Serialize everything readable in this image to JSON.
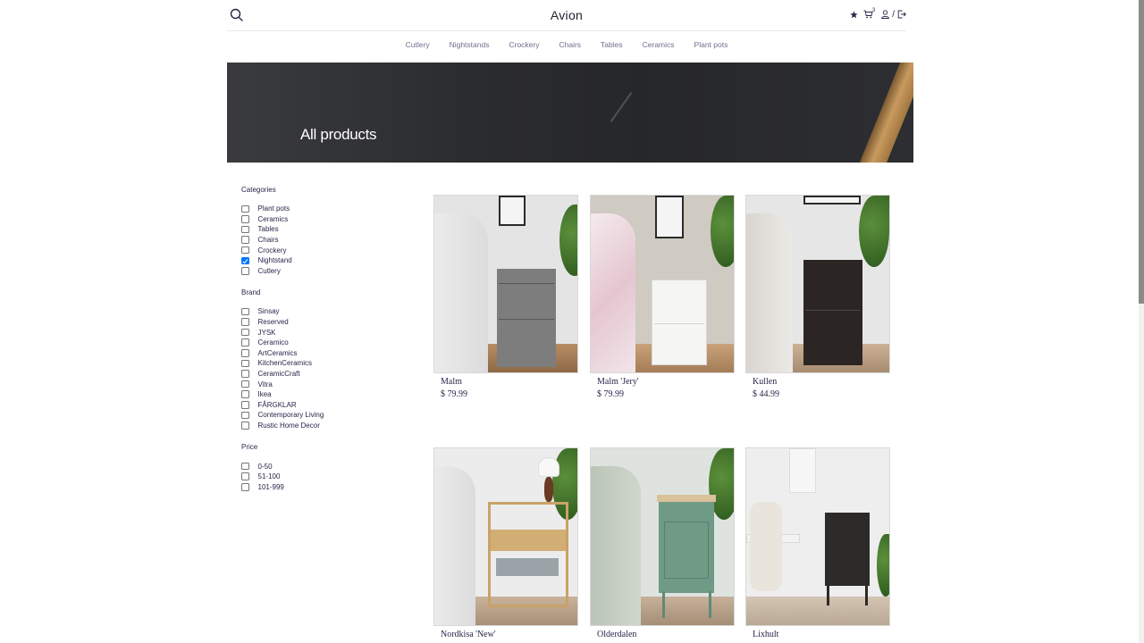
{
  "header": {
    "logo": "Avion",
    "cart_count": "3",
    "separator": "/"
  },
  "nav": {
    "items": [
      "Cutlery",
      "Nightstands",
      "Crockery",
      "Chairs",
      "Tables",
      "Ceramics",
      "Plant pots"
    ]
  },
  "hero": {
    "title": "All products"
  },
  "filters": {
    "categories": {
      "title": "Categories",
      "options": [
        {
          "label": "Plant pots",
          "checked": false
        },
        {
          "label": "Ceramics",
          "checked": false
        },
        {
          "label": "Tables",
          "checked": false
        },
        {
          "label": "Chairs",
          "checked": false
        },
        {
          "label": "Crockery",
          "checked": false
        },
        {
          "label": "Nightstand",
          "checked": true
        },
        {
          "label": "Cutlery",
          "checked": false
        }
      ]
    },
    "brand": {
      "title": "Brand",
      "options": [
        {
          "label": "Sinsay",
          "checked": false
        },
        {
          "label": "Reserved",
          "checked": false
        },
        {
          "label": "JYSK",
          "checked": false
        },
        {
          "label": "Ceramico",
          "checked": false
        },
        {
          "label": "ArtCeramics",
          "checked": false
        },
        {
          "label": "KitchenCeramics",
          "checked": false
        },
        {
          "label": "CeramicCraft",
          "checked": false
        },
        {
          "label": "Vitra",
          "checked": false
        },
        {
          "label": "Ikea",
          "checked": false
        },
        {
          "label": "FÅRGKLAR",
          "checked": false
        },
        {
          "label": "Contemporary Living",
          "checked": false
        },
        {
          "label": "Rustic Home Decor",
          "checked": false
        }
      ]
    },
    "price": {
      "title": "Price",
      "options": [
        {
          "label": "0-50",
          "checked": false
        },
        {
          "label": "51-100",
          "checked": false
        },
        {
          "label": "101-999",
          "checked": false
        }
      ]
    }
  },
  "products": [
    {
      "name": "Malm",
      "price": "$ 79.99",
      "cabinet_color": "#7d7d7d",
      "wall_color": "#e4e4e4"
    },
    {
      "name": "Malm 'Jery'",
      "price": "$ 79.99",
      "cabinet_color": "#f3f3f1",
      "wall_color": "#cfcac2"
    },
    {
      "name": "Kullen",
      "price": "$ 44.99",
      "cabinet_color": "#2b2623",
      "wall_color": "#e6e6e6"
    },
    {
      "name": "Nordkisa 'New'",
      "price": "",
      "cabinet_color": "#c9a268",
      "wall_color": "#ececec"
    },
    {
      "name": "Olderdalen",
      "price": "",
      "cabinet_color": "#6f9a86",
      "wall_color": "#dfe3df"
    },
    {
      "name": "Lixhult",
      "price": "",
      "cabinet_color": "#2d2b29",
      "wall_color": "#eeeeee"
    }
  ],
  "colors": {
    "accent": "#2a254b",
    "muted": "#726e8d",
    "checkbox_checked": "#0075ff"
  }
}
